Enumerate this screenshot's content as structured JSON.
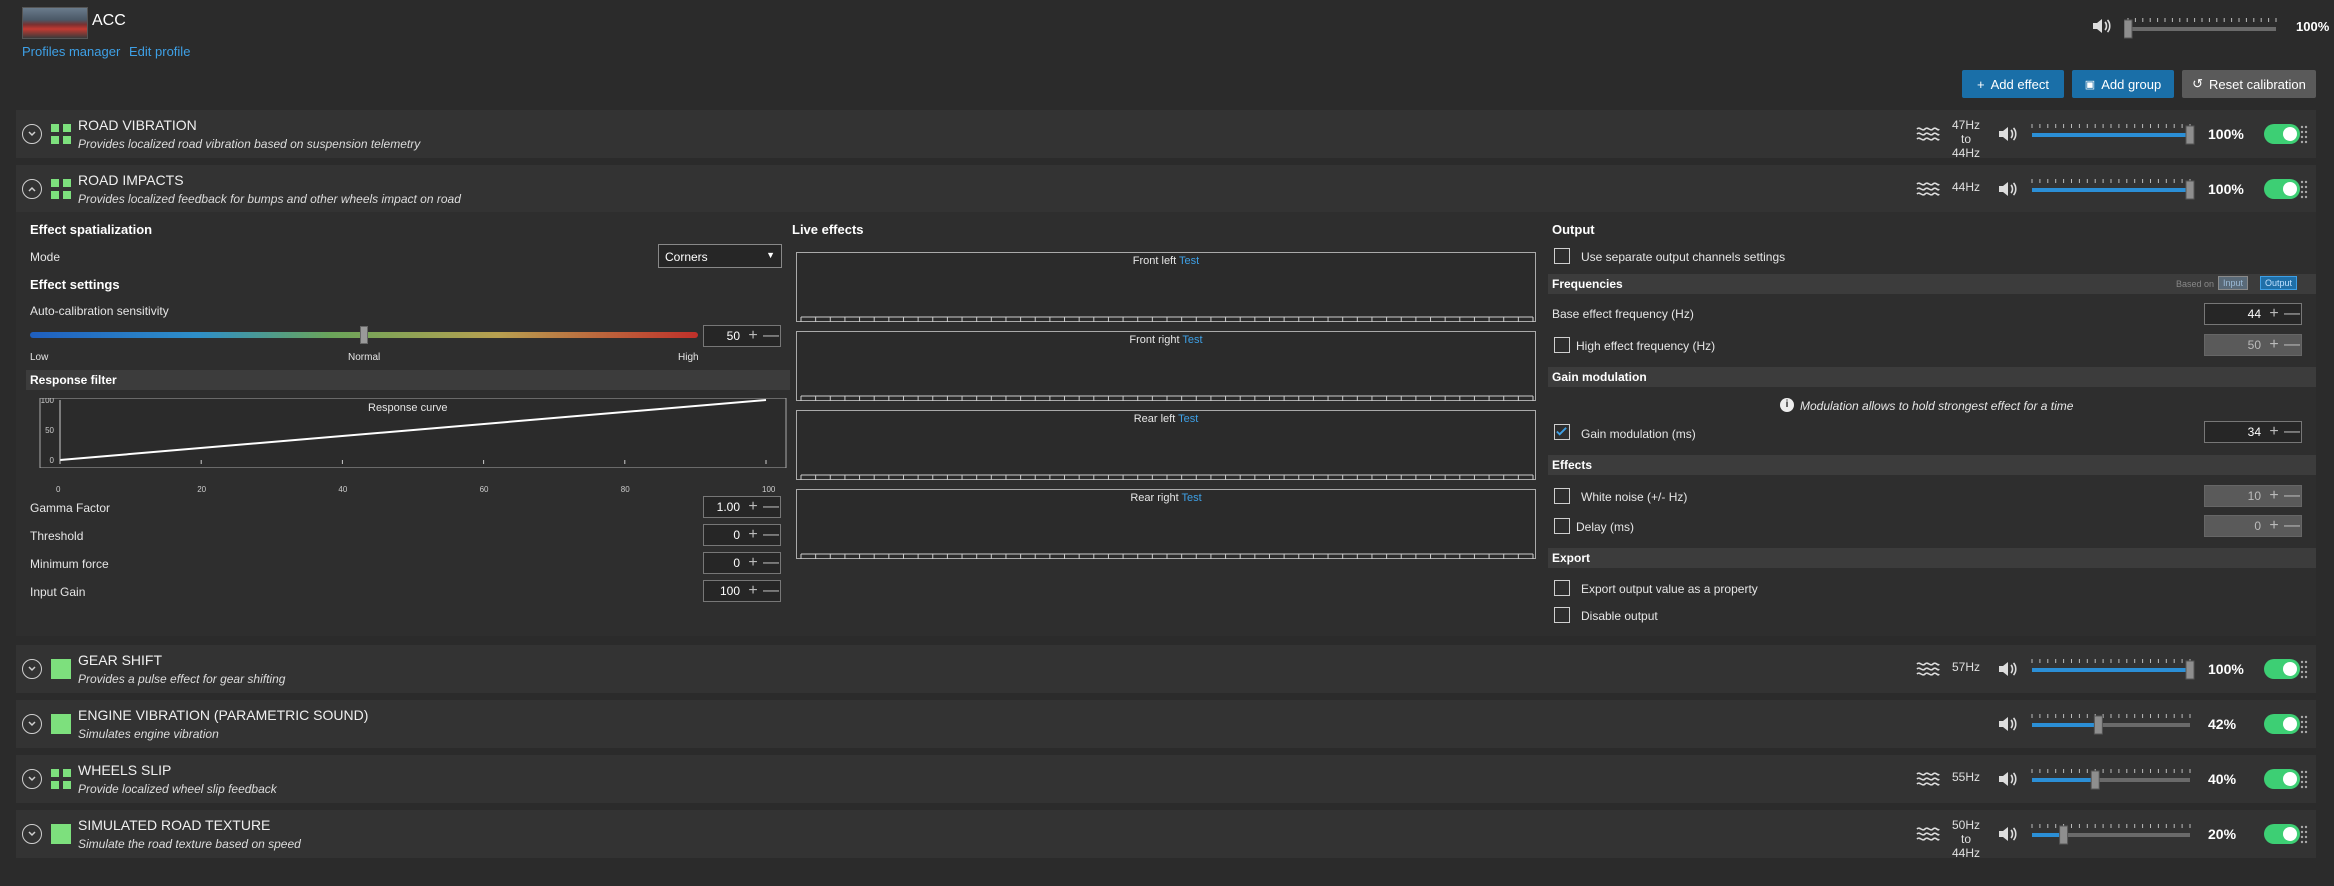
{
  "app": {
    "title": "ACC",
    "profiles_manager": "Profiles manager",
    "edit_profile": "Edit profile",
    "master_volume": "100%",
    "master_volume_value": 1.0
  },
  "toolbar": {
    "add_effect": "Add effect",
    "add_group": "Add group",
    "reset_calibration": "Reset calibration"
  },
  "effects": [
    {
      "title": "ROAD VIBRATION",
      "subtitle": "Provides localized road vibration based on suspension telemetry",
      "freq_line1": "47Hz",
      "freq_line2": "to 44Hz",
      "volume": "100%",
      "level": 1.0,
      "icon": "grid-icon",
      "expanded": false
    },
    {
      "title": "ROAD IMPACTS",
      "subtitle": "Provides localized feedback for bumps and other wheels impact on road",
      "freq_line1": "44Hz",
      "freq_line2": "",
      "volume": "100%",
      "level": 1.0,
      "icon": "grid-icon",
      "expanded": true
    },
    {
      "title": "GEAR SHIFT",
      "subtitle": "Provides a pulse effect for gear shifting",
      "freq_line1": "57Hz",
      "freq_line2": "",
      "volume": "100%",
      "level": 1.0,
      "icon": "square-icon",
      "expanded": false
    },
    {
      "title": "ENGINE VIBRATION (PARAMETRIC SOUND)",
      "subtitle": "Simulates engine vibration",
      "freq_line1": "",
      "freq_line2": "",
      "volume": "42%",
      "level": 0.42,
      "icon": "square-icon",
      "expanded": false
    },
    {
      "title": "WHEELS SLIP",
      "subtitle": "Provide localized wheel slip feedback",
      "freq_line1": "55Hz",
      "freq_line2": "",
      "volume": "40%",
      "level": 0.4,
      "icon": "grid-icon",
      "expanded": false
    },
    {
      "title": "SIMULATED ROAD TEXTURE",
      "subtitle": "Simulate the road texture based on speed",
      "freq_line1": "50Hz",
      "freq_line2": "to 44Hz",
      "volume": "20%",
      "level": 0.2,
      "icon": "square-icon",
      "expanded": false
    }
  ],
  "settings": {
    "spatialization_header": "Effect spatialization",
    "mode_label": "Mode",
    "mode_value": "Corners",
    "settings_header": "Effect settings",
    "autocal_label": "Auto-calibration sensitivity",
    "autocal_value": "50",
    "autocal_level": 0.5,
    "scale_low": "Low",
    "scale_normal": "Normal",
    "scale_high": "High",
    "response_filter": "Response filter",
    "response_curve": "Response curve",
    "y_ticks": [
      "100",
      "50",
      "0"
    ],
    "x_ticks": [
      "0",
      "20",
      "40",
      "60",
      "80",
      "100"
    ],
    "gamma_label": "Gamma Factor",
    "gamma_value": "1.00",
    "threshold_label": "Threshold",
    "threshold_value": "0",
    "minforce_label": "Minimum force",
    "minforce_value": "0",
    "inputgain_label": "Input Gain",
    "inputgain_value": "100"
  },
  "live": {
    "header": "Live effects",
    "test": "Test",
    "channels": [
      "Front left",
      "Front right",
      "Rear left",
      "Rear right"
    ]
  },
  "output": {
    "header": "Output",
    "separate_channels": "Use separate output channels settings",
    "frequencies": "Frequencies",
    "based_on": "Based on",
    "tag_input": "Input",
    "tag_output": "Output",
    "base_freq_label": "Base effect frequency (Hz)",
    "base_freq_value": "44",
    "high_freq_label": "High effect frequency (Hz)",
    "high_freq_value": "50",
    "gain_mod_header": "Gain modulation",
    "gain_mod_info": "Modulation allows to hold strongest effect for a time",
    "gain_mod_label": "Gain modulation (ms)",
    "gain_mod_value": "34",
    "gain_mod_checked": true,
    "effects_header": "Effects",
    "white_noise_label": "White noise (+/- Hz)",
    "white_noise_value": "10",
    "delay_label": "Delay (ms)",
    "delay_value": "0",
    "export_header": "Export",
    "export_label": "Export output value as a property",
    "disable_label": "Disable output"
  }
}
